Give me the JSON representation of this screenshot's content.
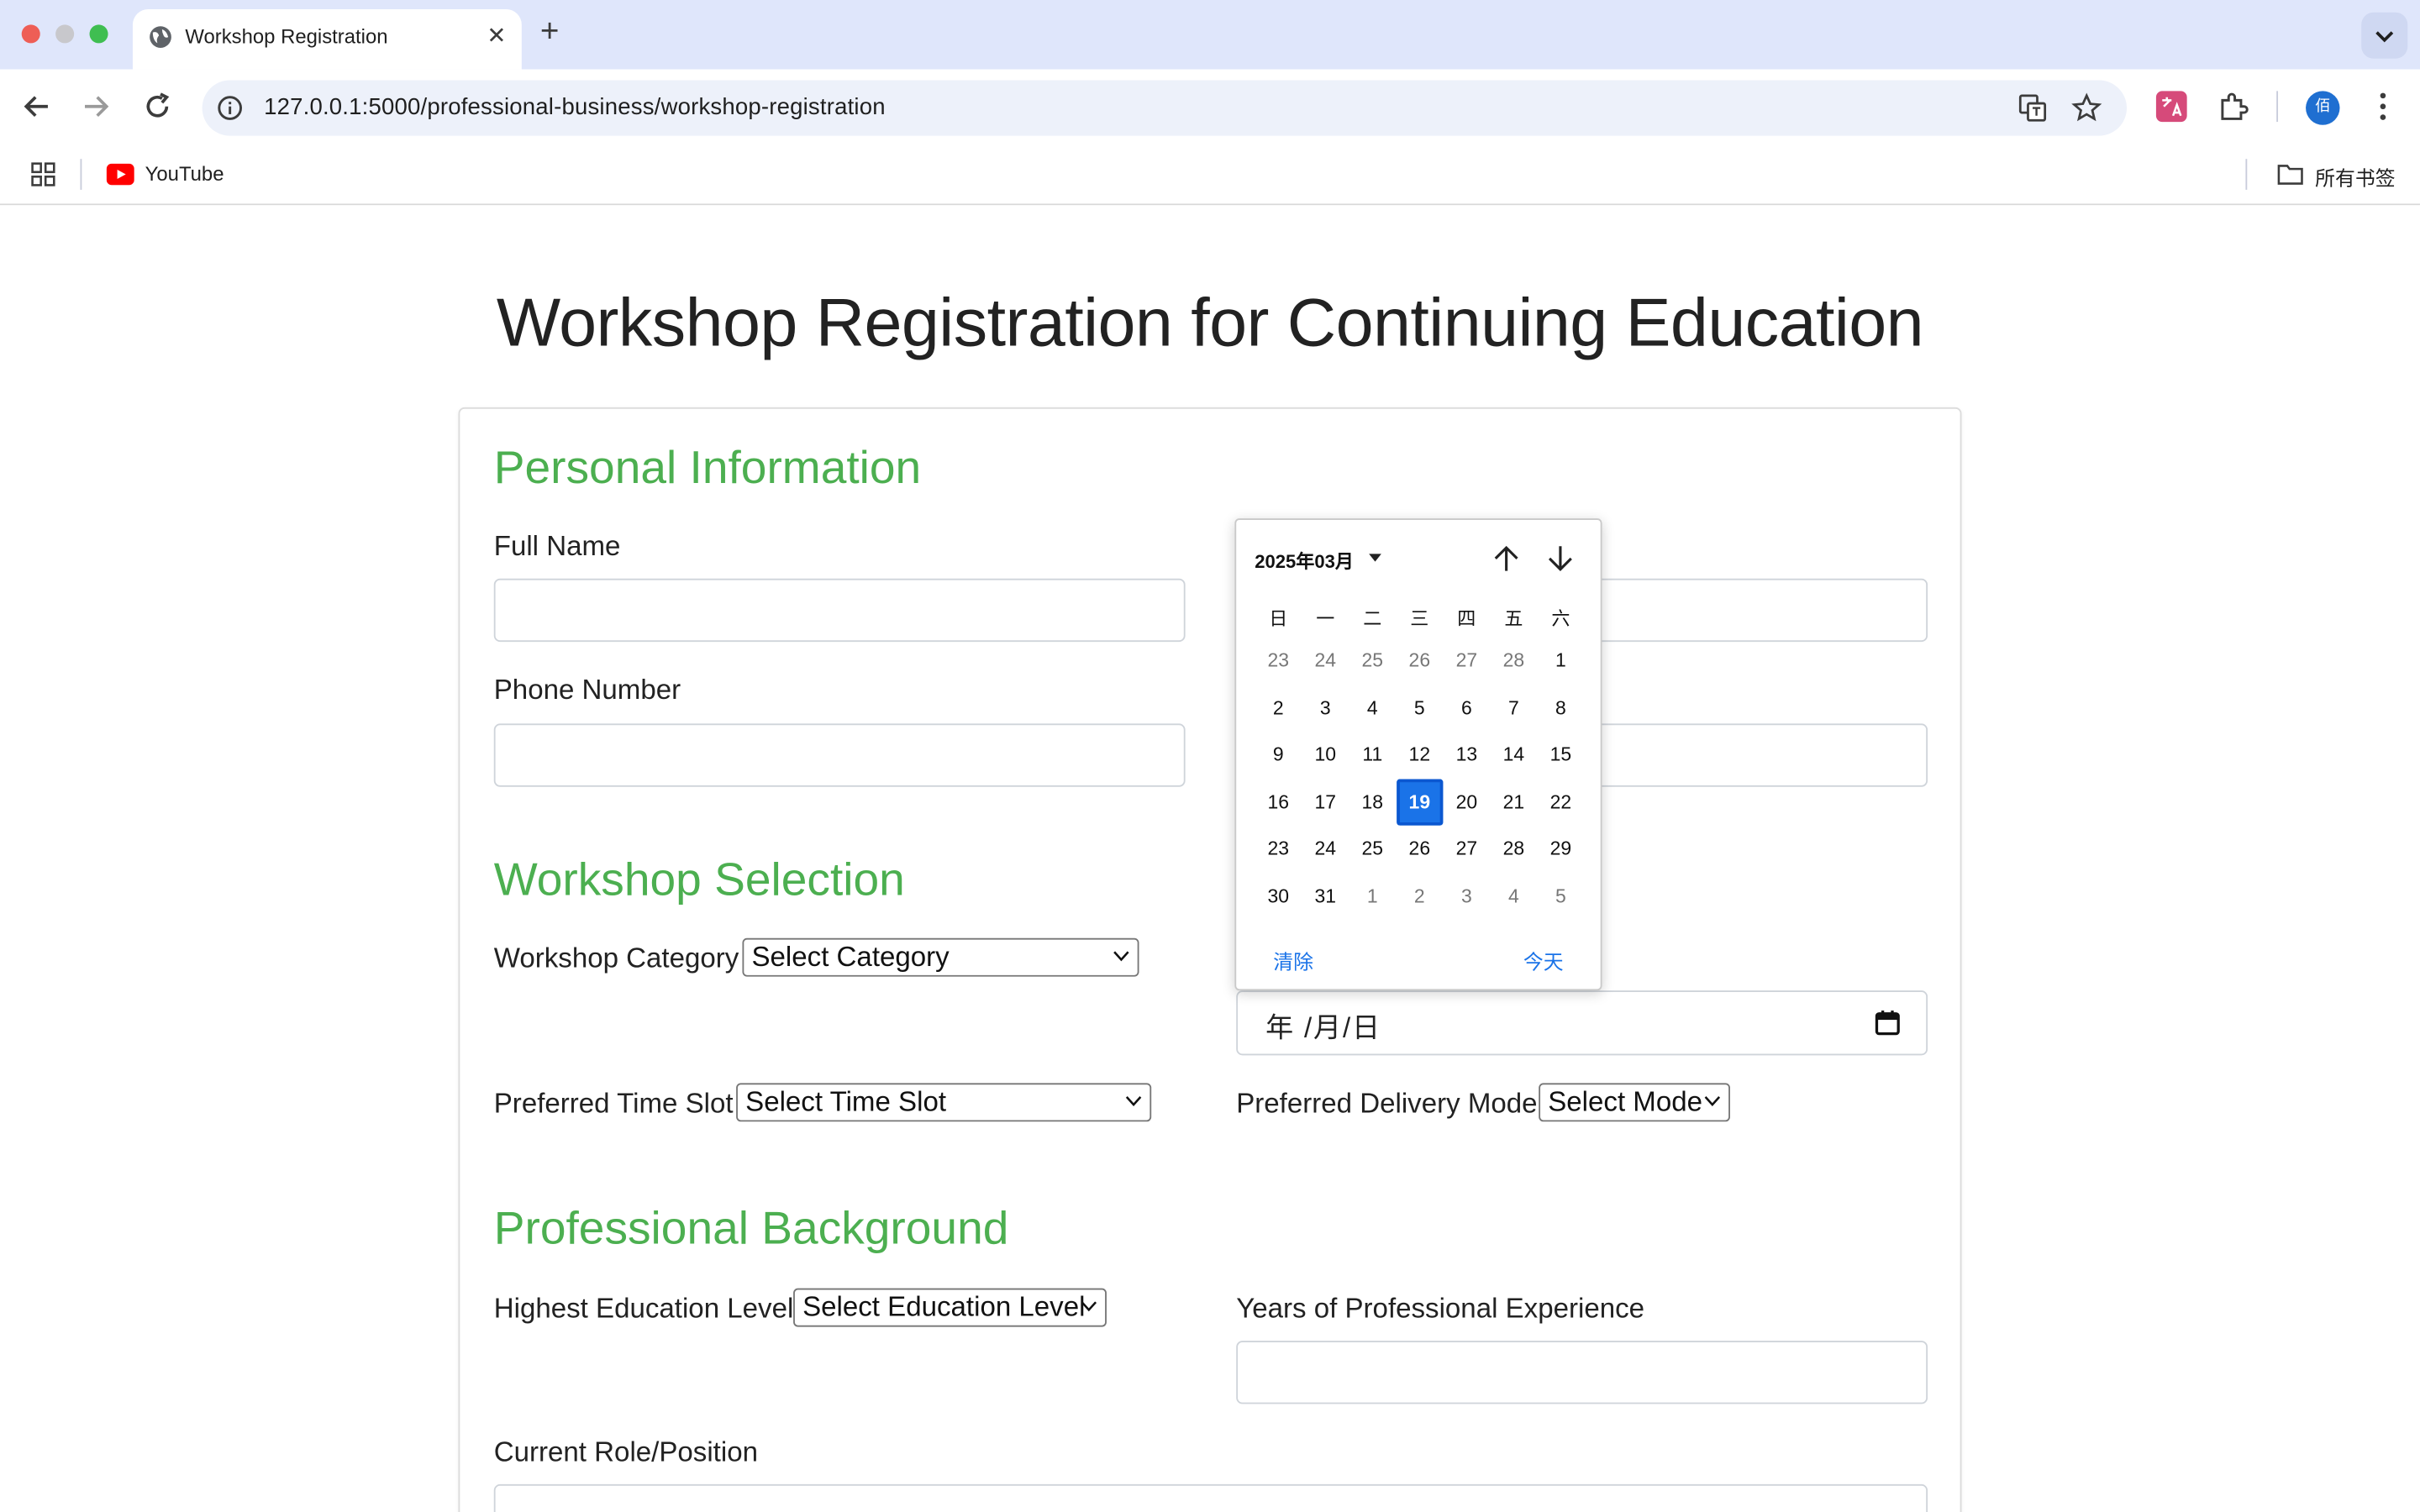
{
  "browser": {
    "tab_title": "Workshop Registration",
    "tab_close": "✕",
    "new_tab": "+",
    "url": "127.0.0.1:5000/professional-business/workshop-registration",
    "bookmarks": [
      {
        "label": "YouTube"
      }
    ],
    "all_bookmarks": "所有书签",
    "profile_initial": "佰"
  },
  "page": {
    "title": "Workshop Registration for Continuing Education",
    "sections": {
      "personal": "Personal Information",
      "workshop": "Workshop Selection",
      "professional": "Professional Background"
    },
    "fields": {
      "full_name": "Full Name",
      "phone": "Phone Number",
      "category": "Workshop Category",
      "category_value": "Select Category",
      "time_slot": "Preferred Time Slot",
      "time_slot_value": "Select Time Slot",
      "delivery": "Preferred Delivery Mode",
      "delivery_value": "Select Mode",
      "education": "Highest Education Level",
      "education_value": "Select Education Level",
      "experience": "Years of Professional Experience",
      "role": "Current Role/Position",
      "date_placeholder": "年 /月/日"
    }
  },
  "datepicker": {
    "month_label": "2025年03月",
    "weekdays": [
      "日",
      "一",
      "二",
      "三",
      "四",
      "五",
      "六"
    ],
    "weeks": [
      [
        {
          "d": "23",
          "o": true
        },
        {
          "d": "24",
          "o": true
        },
        {
          "d": "25",
          "o": true
        },
        {
          "d": "26",
          "o": true
        },
        {
          "d": "27",
          "o": true
        },
        {
          "d": "28",
          "o": true
        },
        {
          "d": "1"
        }
      ],
      [
        {
          "d": "2"
        },
        {
          "d": "3"
        },
        {
          "d": "4"
        },
        {
          "d": "5"
        },
        {
          "d": "6"
        },
        {
          "d": "7"
        },
        {
          "d": "8"
        }
      ],
      [
        {
          "d": "9"
        },
        {
          "d": "10"
        },
        {
          "d": "11"
        },
        {
          "d": "12"
        },
        {
          "d": "13"
        },
        {
          "d": "14"
        },
        {
          "d": "15"
        }
      ],
      [
        {
          "d": "16"
        },
        {
          "d": "17"
        },
        {
          "d": "18"
        },
        {
          "d": "19",
          "sel": true
        },
        {
          "d": "20"
        },
        {
          "d": "21"
        },
        {
          "d": "22"
        }
      ],
      [
        {
          "d": "23"
        },
        {
          "d": "24"
        },
        {
          "d": "25"
        },
        {
          "d": "26"
        },
        {
          "d": "27"
        },
        {
          "d": "28"
        },
        {
          "d": "29"
        }
      ],
      [
        {
          "d": "30"
        },
        {
          "d": "31"
        },
        {
          "d": "1",
          "o": true
        },
        {
          "d": "2",
          "o": true
        },
        {
          "d": "3",
          "o": true
        },
        {
          "d": "4",
          "o": true
        },
        {
          "d": "5",
          "o": true
        }
      ]
    ],
    "clear_label": "清除",
    "today_label": "今天"
  },
  "colors": {
    "section_heading": "#4caf50",
    "selected_day": "#1a73e8",
    "tabbar": "#dfe6fb"
  }
}
